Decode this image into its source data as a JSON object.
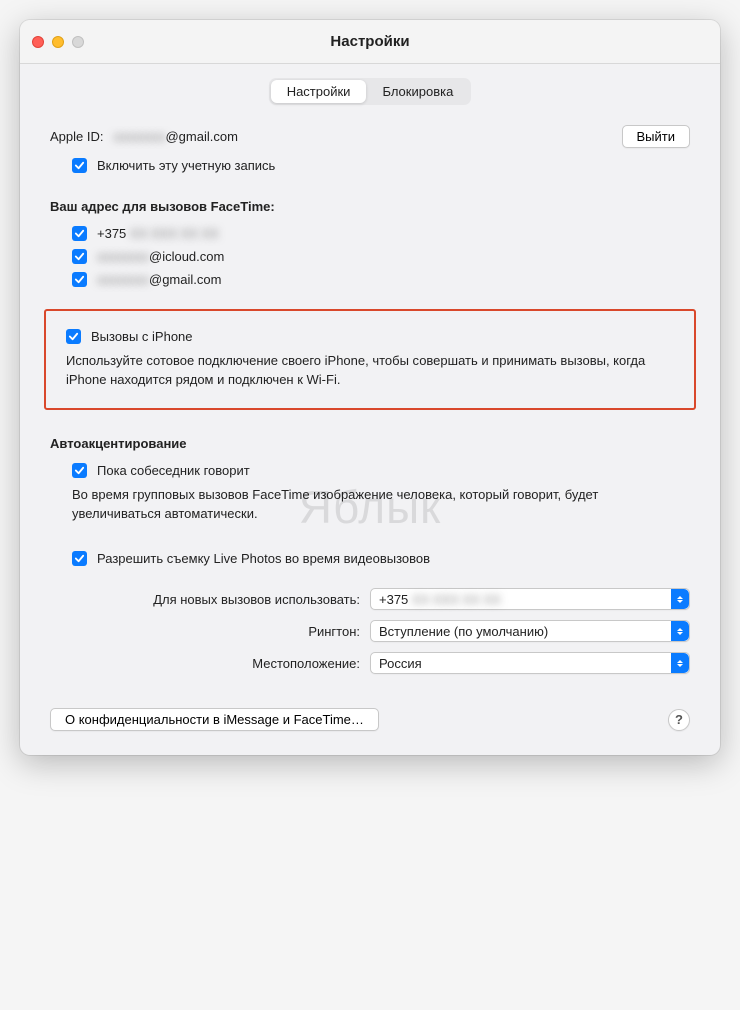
{
  "window": {
    "title": "Настройки"
  },
  "tabs": {
    "settings": "Настройки",
    "blocking": "Блокировка"
  },
  "apple_id": {
    "label": "Apple ID:",
    "masked_user": "xxxxxxxx",
    "domain": "@gmail.com",
    "sign_out": "Выйти",
    "enable_account": "Включить эту учетную запись"
  },
  "facetime_addresses": {
    "heading": "Ваш адрес для вызовов FaceTime:",
    "items": [
      {
        "prefix": "+375",
        "rest_masked": "XX XXX XX XX"
      },
      {
        "masked": "xxxxxxxx",
        "domain": "@icloud.com"
      },
      {
        "masked": "xxxxxxxx",
        "domain": "@gmail.com"
      }
    ]
  },
  "iphone_calls": {
    "label": "Вызовы с iPhone",
    "desc": "Используйте сотовое подключение своего iPhone, чтобы совершать и принимать вызовы, когда iPhone находится рядом и подключен к Wi-Fi."
  },
  "auto_prominence": {
    "heading": "Автоакцентирование",
    "label": "Пока собеседник говорит",
    "desc": "Во время групповых вызовов FaceTime изображение человека, который говорит, будет увеличиваться автоматически."
  },
  "live_photos": {
    "label": "Разрешить съемку Live Photos во время видеовызовов"
  },
  "dropdowns": {
    "start_from": {
      "label": "Для новых вызовов использовать:",
      "value_prefix": "+375",
      "value_rest_masked": "XX XXX XX XX"
    },
    "ringtone": {
      "label": "Рингтон:",
      "value": "Вступление (по умолчанию)"
    },
    "location": {
      "label": "Местоположение:",
      "value": "Россия"
    }
  },
  "privacy_button": "О конфиденциальности в iMessage и FaceTime…",
  "help": "?",
  "watermark": "Яблык"
}
